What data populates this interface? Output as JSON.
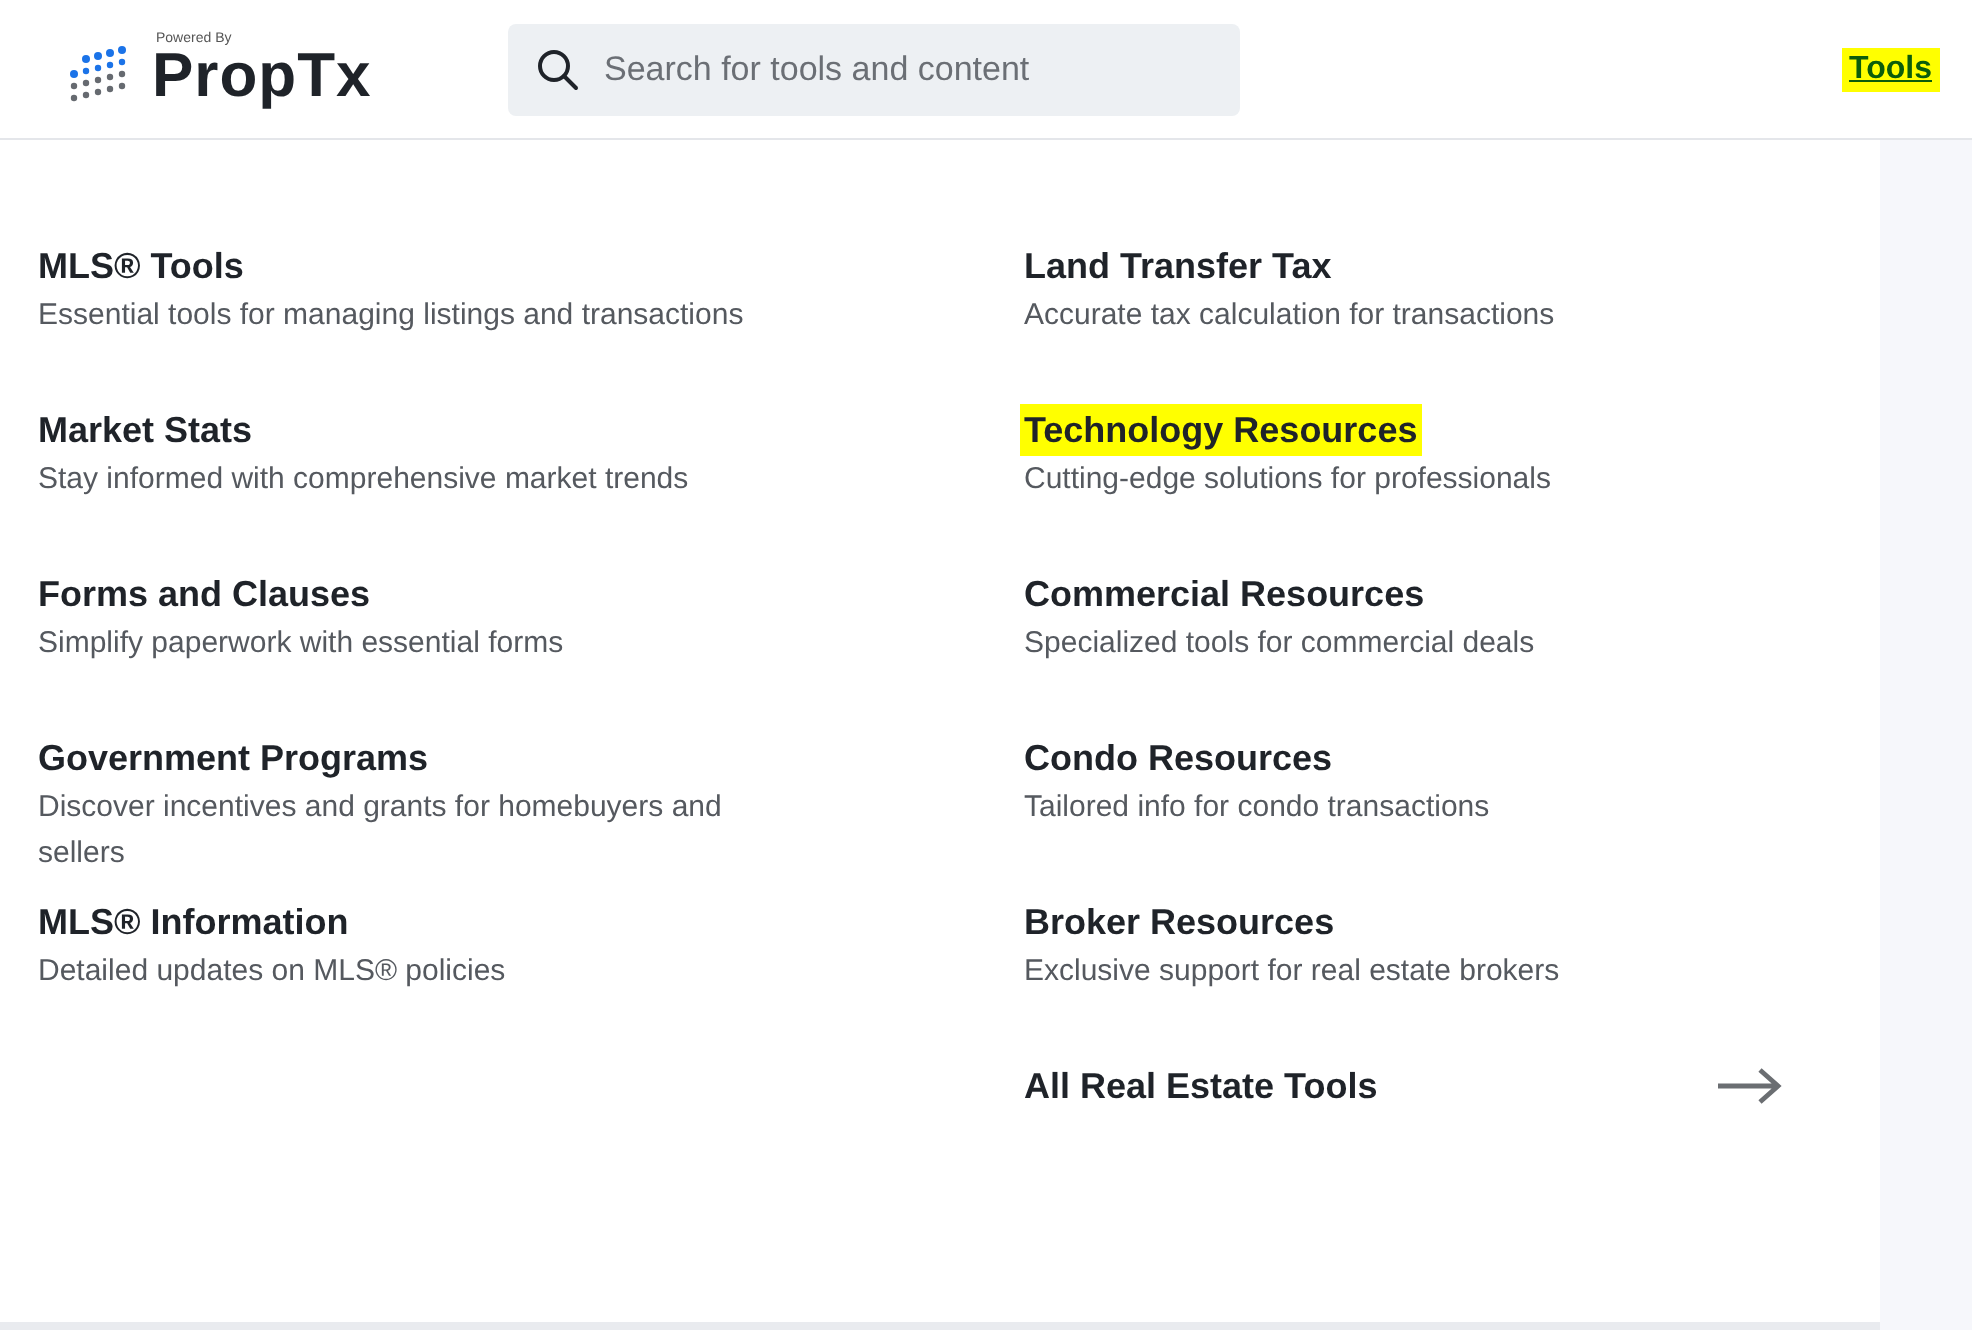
{
  "header": {
    "logo": {
      "tagline": "Powered By",
      "name": "PropTx"
    },
    "search": {
      "placeholder": "Search for tools and content"
    },
    "nav_link": {
      "label": "Tools",
      "highlighted": true
    }
  },
  "menu": {
    "columns": [
      {
        "items": [
          {
            "title": "MLS® Tools",
            "description": "Essential tools for managing listings and transactions",
            "highlighted": false
          },
          {
            "title": "Market Stats",
            "description": "Stay informed with comprehensive market trends",
            "highlighted": false
          },
          {
            "title": "Forms and Clauses",
            "description": "Simplify paperwork with essential forms",
            "highlighted": false
          },
          {
            "title": "Government Programs",
            "description": "Discover incentives and grants for homebuyers and sellers",
            "highlighted": false
          },
          {
            "title": "MLS® Information",
            "description": "Detailed updates on MLS® policies",
            "highlighted": false
          }
        ]
      },
      {
        "items": [
          {
            "title": "Land Transfer Tax",
            "description": "Accurate tax calculation for transactions",
            "highlighted": false
          },
          {
            "title": "Technology Resources",
            "description": "Cutting-edge solutions for professionals",
            "highlighted": true
          },
          {
            "title": "Commercial Resources",
            "description": "Specialized tools for commercial deals",
            "highlighted": false
          },
          {
            "title": "Condo Resources",
            "description": "Tailored info for condo transactions",
            "highlighted": false
          },
          {
            "title": "Broker Resources",
            "description": "Exclusive support for real estate brokers",
            "highlighted": false
          }
        ]
      }
    ],
    "all_link": {
      "label": "All Real Estate Tools"
    }
  }
}
